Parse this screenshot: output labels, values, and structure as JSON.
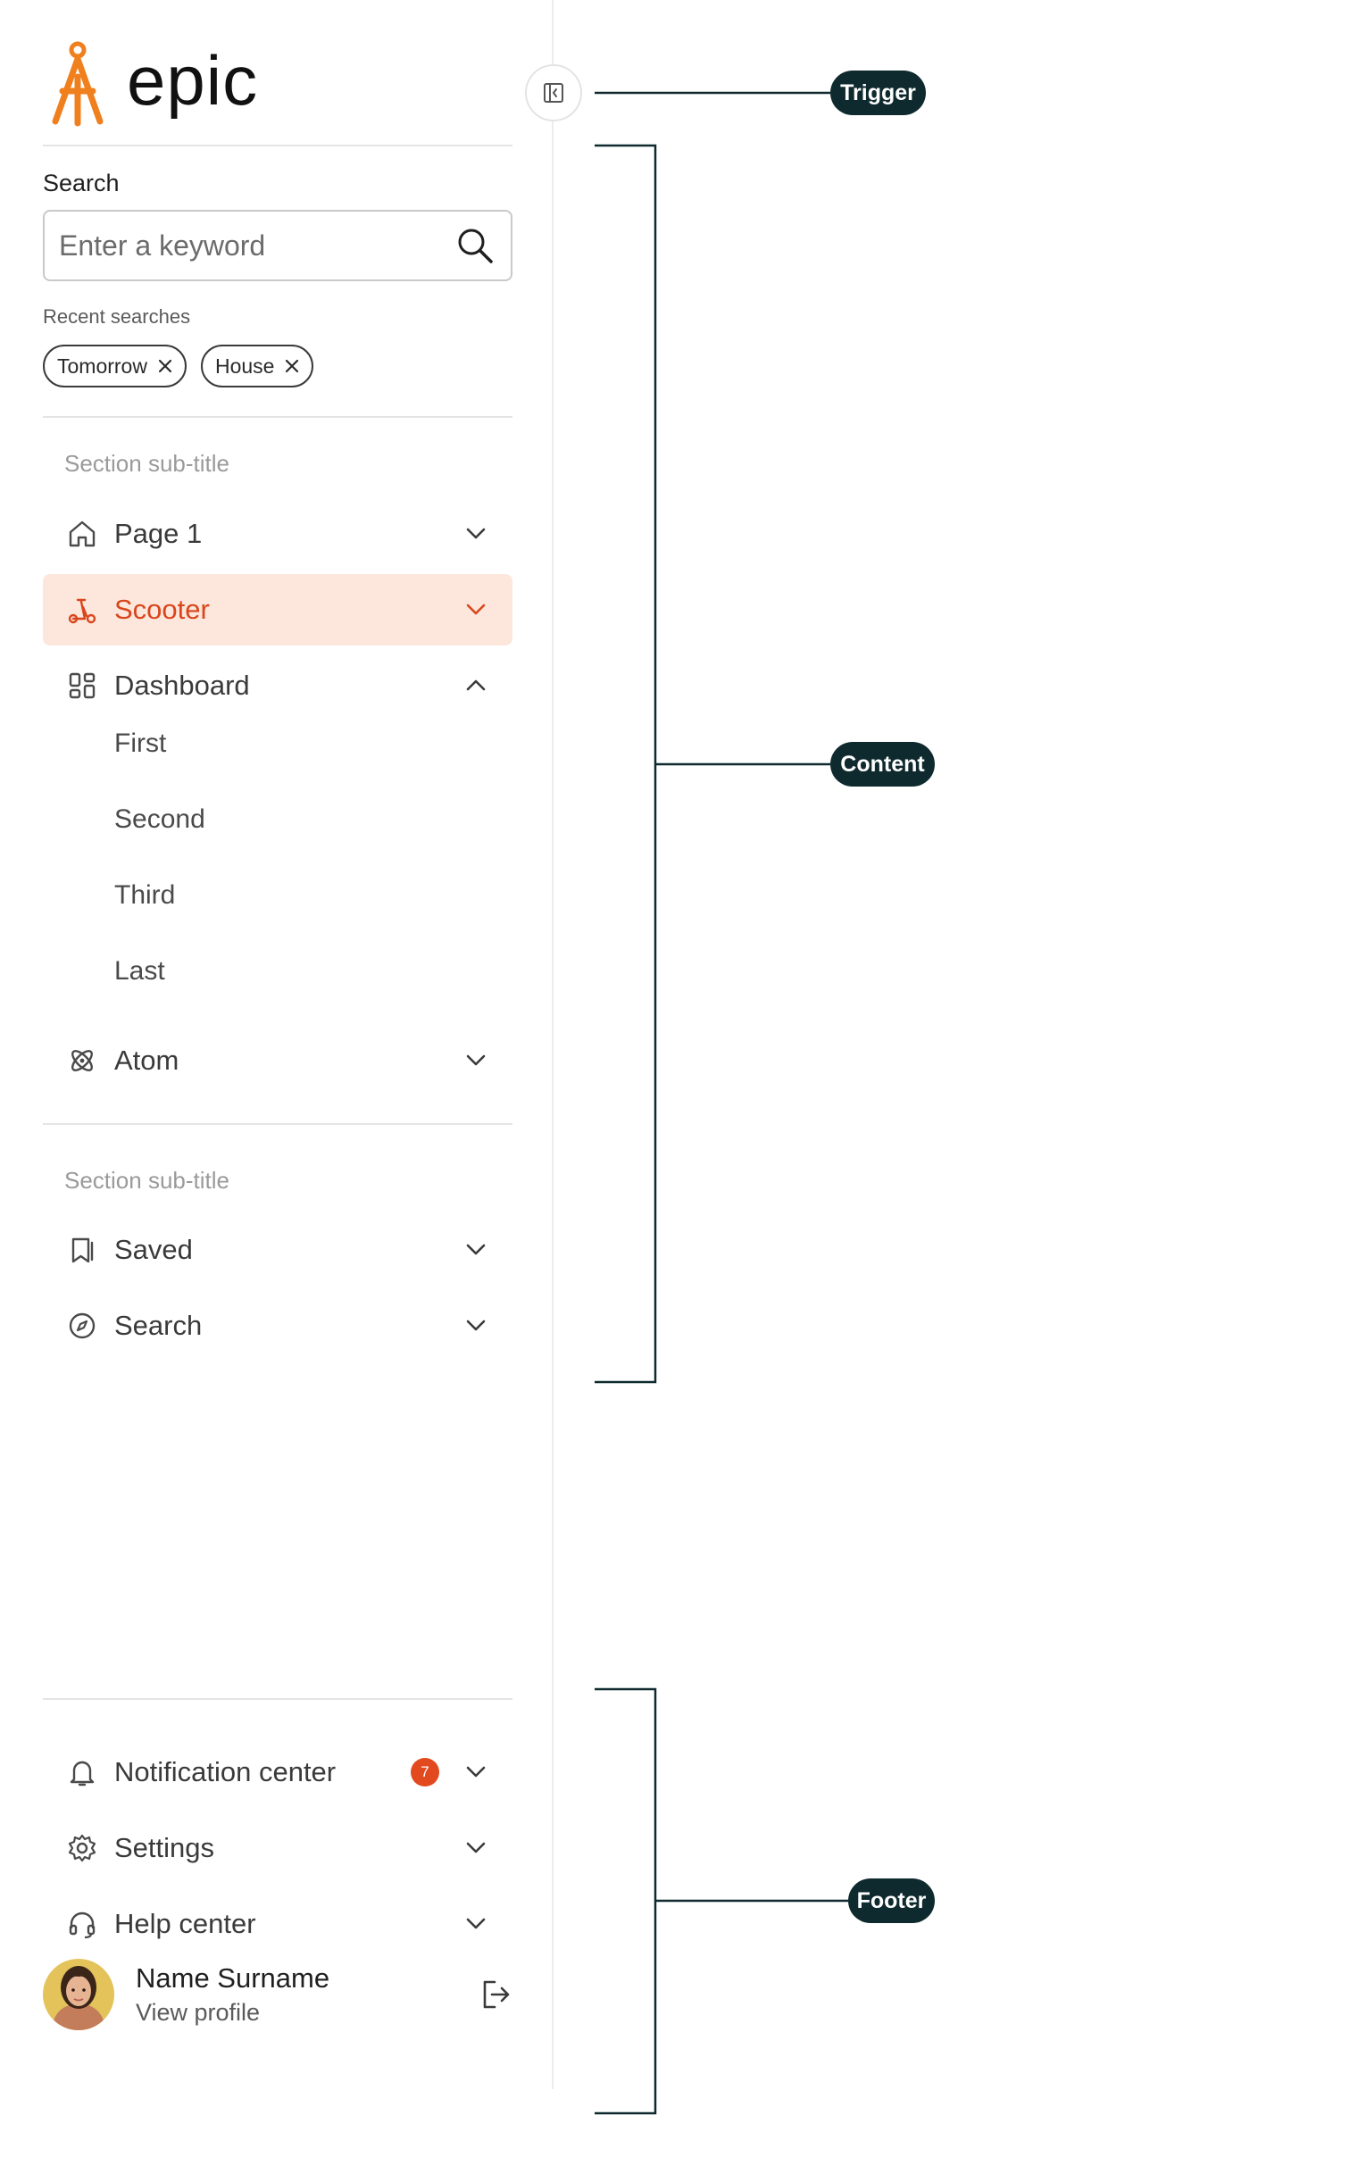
{
  "brand": {
    "name": "epic",
    "accent": "#f07f1d",
    "active_color": "#d9461b",
    "active_bg": "#fde6dc"
  },
  "search": {
    "label": "Search",
    "placeholder": "Enter a keyword",
    "icon": "search-icon",
    "recent_label": "Recent searches",
    "recent": [
      {
        "label": "Tomorrow"
      },
      {
        "label": "House"
      }
    ]
  },
  "sections": [
    {
      "subtitle": "Section sub-title",
      "items": [
        {
          "label": "Page 1",
          "icon": "home-icon",
          "state": "collapsed"
        },
        {
          "label": "Scooter",
          "icon": "scooter-icon",
          "state": "collapsed",
          "active": true
        },
        {
          "label": "Dashboard",
          "icon": "dashboard-icon",
          "state": "expanded",
          "children": [
            {
              "label": "First"
            },
            {
              "label": "Second"
            },
            {
              "label": "Third"
            },
            {
              "label": "Last"
            }
          ]
        },
        {
          "label": "Atom",
          "icon": "atom-icon",
          "state": "collapsed"
        }
      ]
    },
    {
      "subtitle": "Section sub-title",
      "items": [
        {
          "label": "Saved",
          "icon": "bookmark-icon",
          "state": "collapsed"
        },
        {
          "label": "Search",
          "icon": "compass-icon",
          "state": "collapsed"
        }
      ]
    }
  ],
  "footer": {
    "items": [
      {
        "label": "Notification center",
        "icon": "bell-icon",
        "badge": "7",
        "state": "collapsed"
      },
      {
        "label": "Settings",
        "icon": "gear-icon",
        "state": "collapsed"
      },
      {
        "label": "Help center",
        "icon": "headset-icon",
        "state": "collapsed"
      }
    ],
    "profile": {
      "name": "Name Surname",
      "link": "View profile",
      "icon": "logout-icon"
    }
  },
  "annotations": {
    "trigger": "Trigger",
    "content": "Content",
    "footer": "Footer",
    "color": "#0f2a2e"
  }
}
